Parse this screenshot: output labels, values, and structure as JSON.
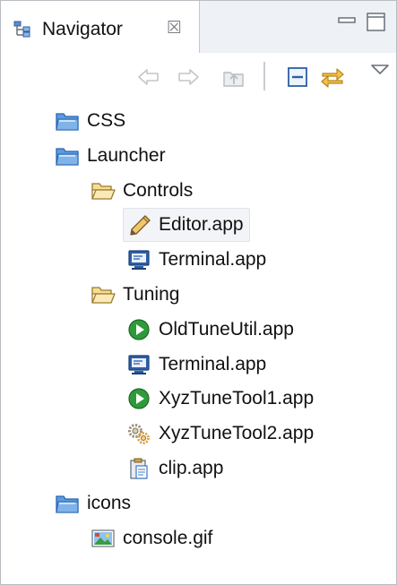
{
  "view": {
    "tab_title": "Navigator",
    "close_glyph": "☒"
  },
  "toolbar": {
    "items": [
      {
        "icon": "back-arrow-icon",
        "enabled": false
      },
      {
        "icon": "forward-arrow-icon",
        "enabled": false
      },
      {
        "icon": "up-folder-icon",
        "enabled": false
      },
      {
        "icon": "collapse-all-icon",
        "enabled": true
      },
      {
        "icon": "link-with-editor-icon",
        "enabled": true
      },
      {
        "icon": "view-menu-icon",
        "enabled": true
      }
    ]
  },
  "tree": [
    {
      "label": "CSS",
      "icon": "project-folder-icon",
      "depth": 0
    },
    {
      "label": "Launcher",
      "icon": "project-folder-icon",
      "depth": 0
    },
    {
      "label": "Controls",
      "icon": "open-folder-icon",
      "depth": 1
    },
    {
      "label": "Editor.app",
      "icon": "pencil-icon",
      "depth": 2,
      "selected": true
    },
    {
      "label": "Terminal.app",
      "icon": "monitor-icon",
      "depth": 2
    },
    {
      "label": "Tuning",
      "icon": "open-folder-icon",
      "depth": 1
    },
    {
      "label": "OldTuneUtil.app",
      "icon": "run-icon",
      "depth": 2
    },
    {
      "label": "Terminal.app",
      "icon": "monitor-icon",
      "depth": 2
    },
    {
      "label": "XyzTuneTool1.app",
      "icon": "run-icon",
      "depth": 2
    },
    {
      "label": "XyzTuneTool2.app",
      "icon": "gears-icon",
      "depth": 2
    },
    {
      "label": "clip.app",
      "icon": "clipboard-icon",
      "depth": 2
    },
    {
      "label": "icons",
      "icon": "project-folder-icon",
      "depth": 0
    },
    {
      "label": "console.gif",
      "icon": "image-file-icon",
      "depth": 1
    }
  ],
  "colors": {
    "folder_blue": "#4a8fd8",
    "run_green": "#2e9a3a",
    "selection": "#f2f4f7"
  }
}
